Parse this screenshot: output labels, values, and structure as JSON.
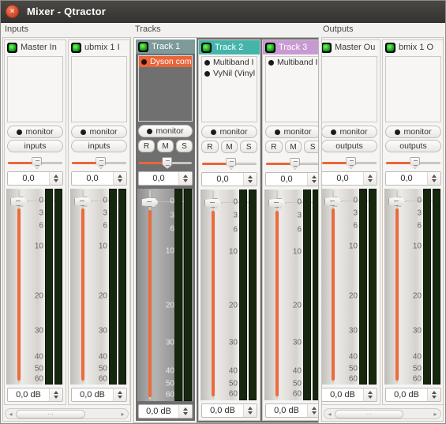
{
  "window": {
    "title": "Mixer - Qtractor",
    "close_icon": "close-icon",
    "close_glyph": "×",
    "titlebar_color": "#3c3a36",
    "close_color": "#d1472a"
  },
  "sections": [
    {
      "label": "Inputs"
    },
    {
      "label": "Tracks"
    },
    {
      "label": "Outputs"
    }
  ],
  "common": {
    "monitor_label": "monitor",
    "inputs_label": "inputs",
    "outputs_label": "outputs",
    "rec_label": "R",
    "mute_label": "M",
    "solo_label": "S",
    "pan_value": "0,0",
    "gain_value": "0,0 dB",
    "led_icon": "signal-led-icon",
    "plugin_bullet_icon": "plugin-bullet-icon",
    "spin_up_icon": "spin-up-arrow-icon",
    "spin_down_icon": "spin-down-arrow-icon",
    "accent_orange": "#e8673b",
    "meter_green": "#17270f"
  },
  "meter_scale": {
    "ticks": [
      "0",
      "3",
      "6",
      "10",
      "20",
      "30",
      "40",
      "50",
      "60"
    ],
    "positions_pct": [
      6,
      12.5,
      19,
      29.5,
      55,
      72.5,
      86,
      92,
      97
    ]
  },
  "inputs": {
    "strips": [
      {
        "name": "Master In",
        "header_color": "transparent",
        "plugins": [],
        "buttons": [
          "monitor",
          "inputs"
        ],
        "pan": "0,0",
        "gain": "0,0 dB"
      },
      {
        "name": "ubmix 1 I",
        "header_color": "transparent",
        "plugins": [],
        "buttons": [
          "monitor",
          "inputs"
        ],
        "pan": "0,0",
        "gain": "0,0 dB"
      }
    ],
    "scrollbar": {
      "left_arrow": "◂",
      "right_arrow": "▸",
      "grip": "⋯"
    }
  },
  "tracks": {
    "strips": [
      {
        "name": "Track 1",
        "header_color": "#7e9a9a",
        "selected": true,
        "plugins": [
          {
            "label": "Dyson com",
            "highlighted": true
          }
        ],
        "pan": "0,0",
        "gain": "0,0 dB"
      },
      {
        "name": "Track 2",
        "header_color": "#45b5ab",
        "selected": false,
        "plugins": [
          {
            "label": "Multiband I",
            "highlighted": false
          },
          {
            "label": "VyNil (Vinyl",
            "highlighted": false
          }
        ],
        "pan": "0,0",
        "gain": "0,0 dB"
      },
      {
        "name": "Track 3",
        "header_color": "#c89ad4",
        "selected": false,
        "plugins": [
          {
            "label": "Multiband I",
            "highlighted": false
          }
        ],
        "pan": "0,0",
        "gain": "0,0 dB"
      }
    ]
  },
  "outputs": {
    "strips": [
      {
        "name": "Master Ou",
        "plugins": [],
        "buttons": [
          "monitor",
          "outputs"
        ],
        "pan": "0,0",
        "gain": "0,0 dB"
      },
      {
        "name": "bmix 1 O",
        "plugins": [],
        "buttons": [
          "monitor",
          "outputs"
        ],
        "pan": "0,0",
        "gain": "0,0 dB"
      }
    ],
    "scrollbar": {
      "left_arrow": "◂",
      "right_arrow": "▸",
      "grip": "⋯"
    }
  }
}
